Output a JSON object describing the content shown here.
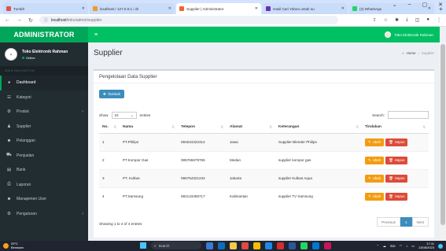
{
  "browser": {
    "tabs": [
      {
        "label": "Tumblr",
        "color": "#e3524a",
        "active": false
      },
      {
        "label": "localhost / 127.0.0.1 / dt",
        "color": "#f09a2a",
        "active": false
      },
      {
        "label": "Supplier | Administrator",
        "color": "#f0652b",
        "active": true
      },
      {
        "label": "Hasil Cari Yahoo untuk su",
        "color": "#6a2fb5",
        "active": false
      },
      {
        "label": "(3) WhatsApp",
        "color": "#25d366",
        "active": false
      }
    ],
    "new_tab": "+",
    "url_host": "localhost",
    "url_path": "/toko/admin/supplier"
  },
  "app": {
    "brand": "ADMINISTRATOR",
    "top_user": "Toko Elektronik Rahman",
    "colors": {
      "brand": "#00a65a",
      "topnav": "#00c064",
      "sidebar": "#222d32"
    }
  },
  "sidebar": {
    "user_name": "Toko Elektronik Rahman",
    "user_status": "Online",
    "menu_header": "MAIN NAVIGATION",
    "items": [
      {
        "label": "Dashboard",
        "icon": "dashboard-icon",
        "glyph": "◕",
        "active": true,
        "chevron": false
      },
      {
        "label": "Kategori",
        "icon": "list-icon",
        "glyph": "☰",
        "active": false,
        "chevron": false
      },
      {
        "label": "Produk",
        "icon": "cubes-icon",
        "glyph": "⚙",
        "active": false,
        "chevron": true
      },
      {
        "label": "Supplier",
        "icon": "user-icon",
        "glyph": "♟",
        "active": false,
        "chevron": false
      },
      {
        "label": "Pelanggan",
        "icon": "users-icon",
        "glyph": "☻",
        "active": false,
        "chevron": false
      },
      {
        "label": "Penjualan",
        "icon": "cart-icon",
        "glyph": "⛟",
        "active": false,
        "chevron": false
      },
      {
        "label": "Bank",
        "icon": "bank-icon",
        "glyph": "▤",
        "active": false,
        "chevron": false
      },
      {
        "label": "Laporan",
        "icon": "print-icon",
        "glyph": "⎙",
        "active": false,
        "chevron": false
      },
      {
        "label": "Manajemen User",
        "icon": "users-cog-icon",
        "glyph": "☻",
        "active": false,
        "chevron": false
      },
      {
        "label": "Pengaturan",
        "icon": "gear-icon",
        "glyph": "⚙",
        "active": false,
        "chevron": true
      }
    ]
  },
  "content": {
    "page_title": "Supplier",
    "breadcrumb_home": "Home",
    "breadcrumb_current": "Supplier",
    "box_title": "Pengelolaan Data Supplier",
    "add_button": "Tambah",
    "show_label": "Show",
    "show_value": "10",
    "entries_label": "entries",
    "search_label": "Search:",
    "columns": [
      "No.",
      "Nama",
      "Telepon",
      "Alamat",
      "Keterangan",
      "Tindakan"
    ],
    "rows": [
      {
        "no": "1",
        "nama": "PT.Philips",
        "telepon": "084534322312",
        "alamat": "Jawa",
        "keterangan": "Supplier Blender Philips"
      },
      {
        "no": "2",
        "nama": "PT.Kompor Gas",
        "telepon": "085765678765",
        "alamat": "Medan",
        "keterangan": "supplier kompor gas"
      },
      {
        "no": "3",
        "nama": "PT. Kulkas",
        "telepon": "086754321234",
        "alamat": "Jakarta",
        "keterangan": "supplier Kulkas Aqua"
      },
      {
        "no": "4",
        "nama": "PT.Samsung",
        "telepon": "082143456717",
        "alamat": "Kalimantan",
        "keterangan": "supplier TV Samsung"
      }
    ],
    "edit_label": "Ubah",
    "delete_label": "Hapus",
    "info_text": "Showing 1 to 4 of 4 entries",
    "pager_prev": "Previous",
    "pager_current": "1",
    "pager_next": "Next"
  },
  "taskbar": {
    "temp": "29°C",
    "weather": "Berawan",
    "search": "Search",
    "lang": "IND",
    "time": "17:11",
    "date": "13/08/2023"
  }
}
